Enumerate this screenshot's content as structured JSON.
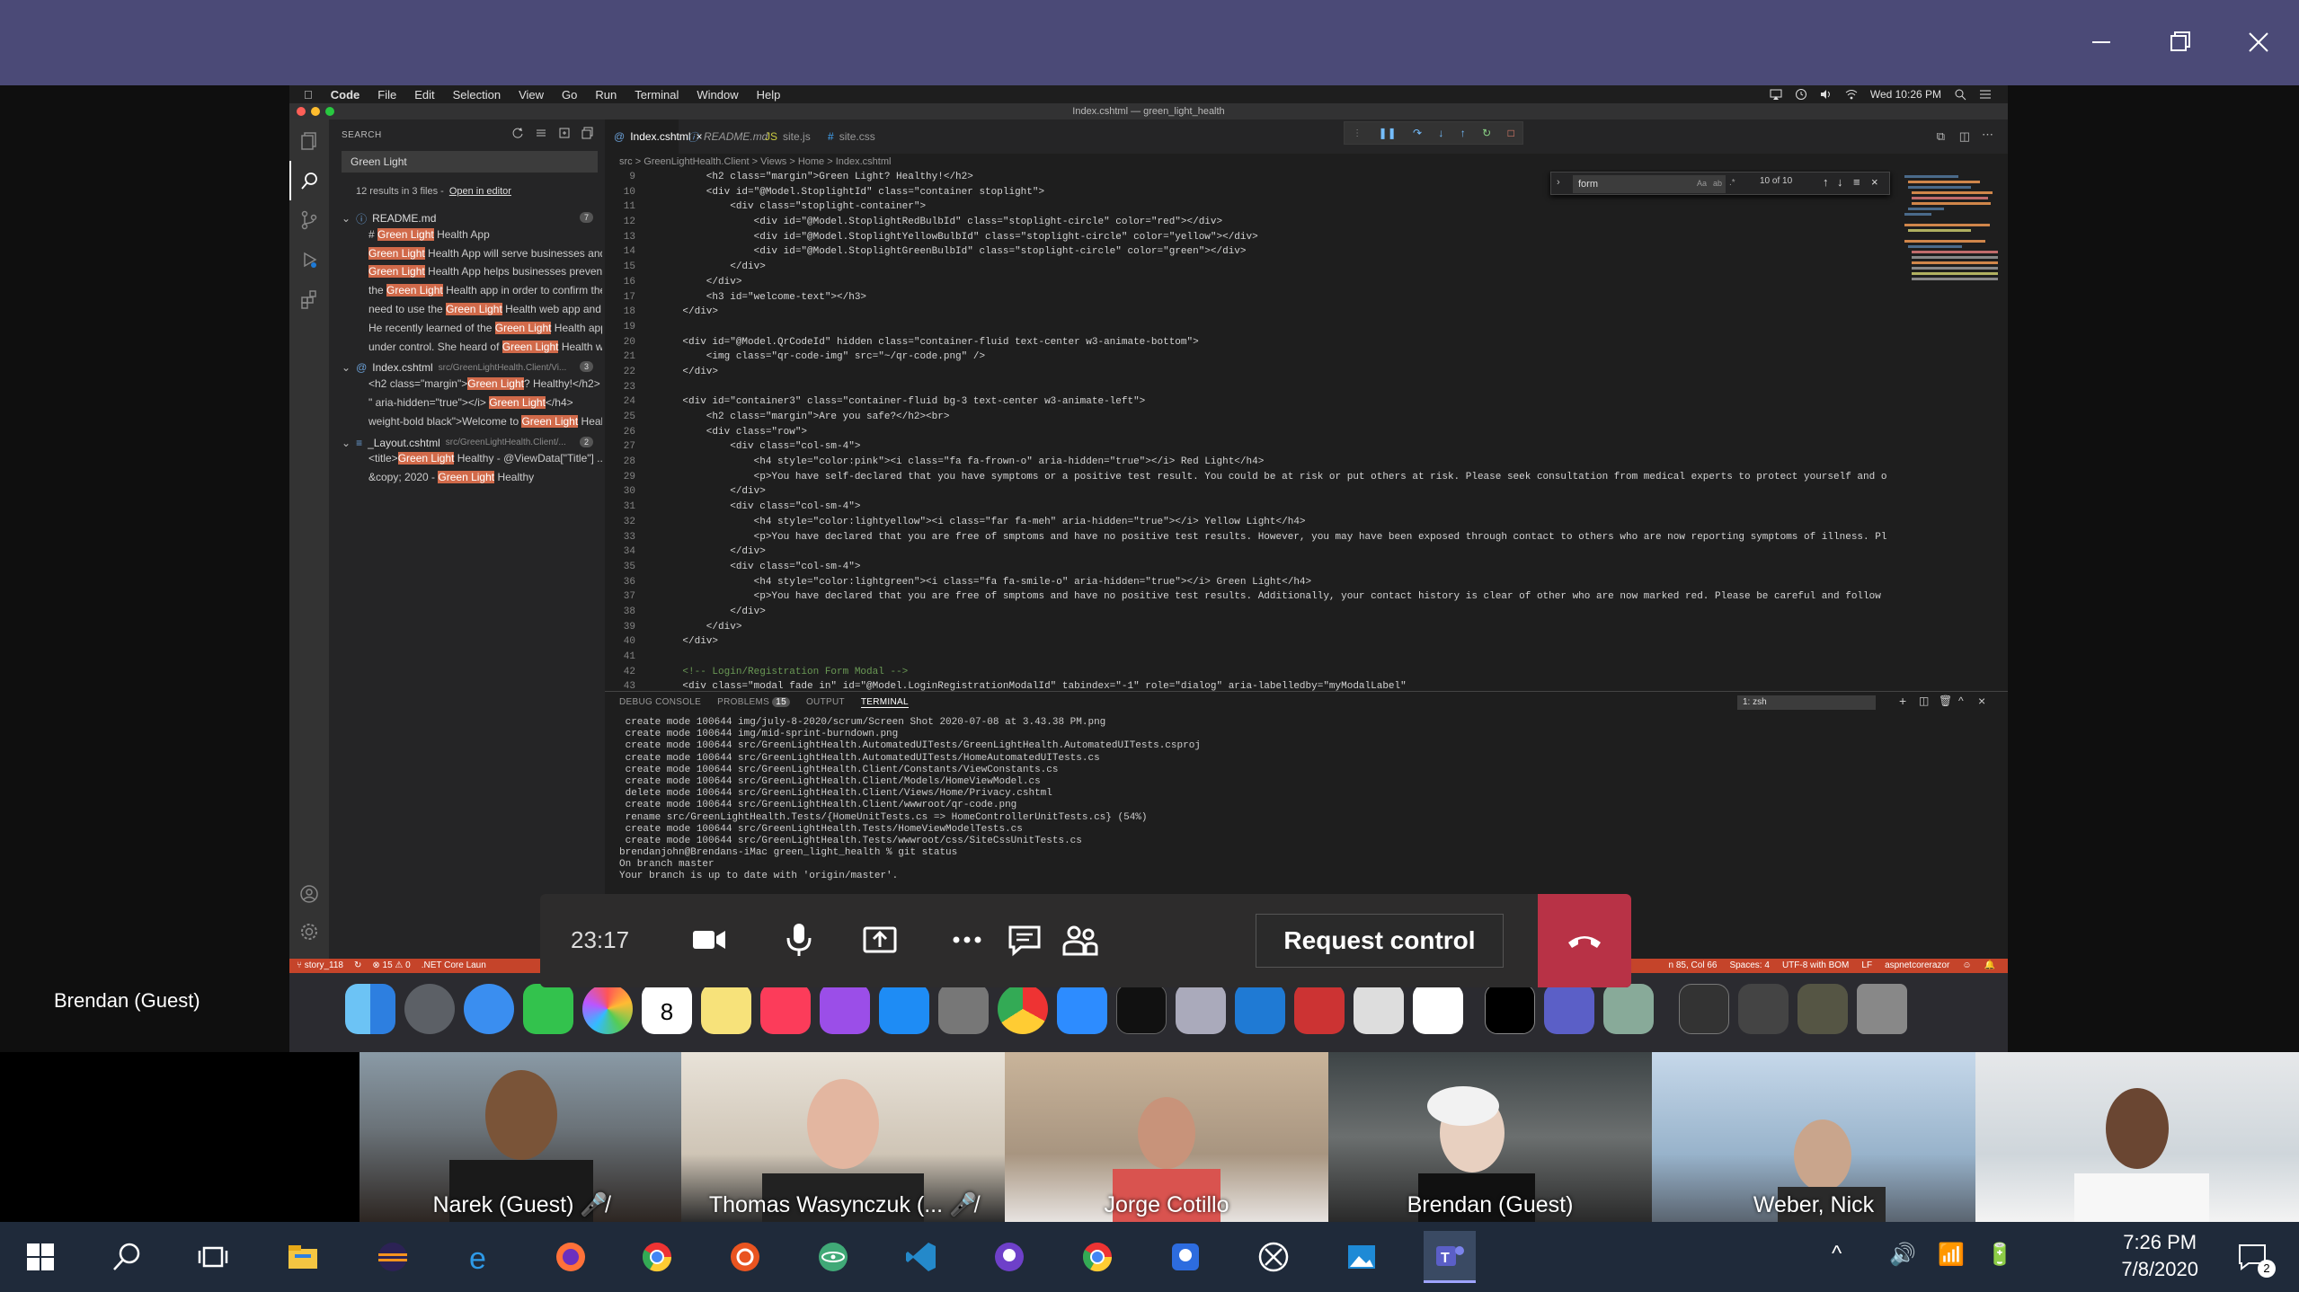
{
  "teams": {
    "presenter": "Brendan (Guest)",
    "timer": "23:17",
    "request_control": "Request control"
  },
  "mac_menubar": {
    "items": [
      "Code",
      "File",
      "Edit",
      "Selection",
      "View",
      "Go",
      "Run",
      "Terminal",
      "Window",
      "Help"
    ],
    "clock": "Wed 10:26 PM"
  },
  "vscode": {
    "window_title": "Index.cshtml — green_light_health",
    "sidebar": {
      "header": "SEARCH",
      "query": "Green Light",
      "summary": "12 results in 3 files -",
      "open_in_editor": "Open in editor",
      "files": [
        {
          "name": "README.md",
          "path": "",
          "count": "7",
          "lines": [
            {
              "pre": "# ",
              "hl": "Green Light",
              "post": " Health App"
            },
            {
              "pre": "",
              "hl": "Green Light",
              "post": " Health App will serve businesses and ..."
            },
            {
              "pre": "",
              "hl": "Green Light",
              "post": " Health App helps businesses prevent ..."
            },
            {
              "pre": "the ",
              "hl": "Green Light",
              "post": " Health app in order to confirm the..."
            },
            {
              "pre": "need to use the ",
              "hl": "Green Light",
              "post": " Health web app and c..."
            },
            {
              "pre": "He recently learned of the ",
              "hl": "Green Light",
              "post": " Health app..."
            },
            {
              "pre": "under control. She heard of ",
              "hl": "Green Light",
              "post": " Health we..."
            }
          ]
        },
        {
          "name": "Index.cshtml",
          "path": "src/GreenLightHealth.Client/Vi...",
          "count": "3",
          "lines": [
            {
              "pre": "<h2 class=\"margin\">",
              "hl": "Green Light",
              "post": "? Healthy!</h2>"
            },
            {
              "pre": "\" aria-hidden=\"true\"></i> ",
              "hl": "Green Light",
              "post": "</h4>"
            },
            {
              "pre": "weight-bold black\">Welcome to ",
              "hl": "Green Light",
              "post": " Healt..."
            }
          ]
        },
        {
          "name": "_Layout.cshtml",
          "path": "src/GreenLightHealth.Client/...",
          "count": "2",
          "lines": [
            {
              "pre": "<title>",
              "hl": "Green Light",
              "post": " Healthy - @ViewData[\"Title\"] ..."
            },
            {
              "pre": "&copy; 2020 - ",
              "hl": "Green Light",
              "post": " Healthy"
            }
          ]
        }
      ]
    },
    "tabs": [
      "Index.cshtml",
      "README.md",
      "site.js",
      "site.css"
    ],
    "breadcrumb": "src > GreenLightHealth.Client > Views > Home > Index.cshtml",
    "find": {
      "query": "form",
      "count": "10 of 10"
    },
    "line_numbers": [
      "9",
      "10",
      "11",
      "12",
      "13",
      "14",
      "15",
      "16",
      "17",
      "18",
      "19",
      "20",
      "21",
      "22",
      "23",
      "24",
      "25",
      "26",
      "27",
      "28",
      "29",
      "30",
      "31",
      "32",
      "33",
      "34",
      "35",
      "36",
      "37",
      "38",
      "39",
      "40",
      "41",
      "42",
      "43"
    ],
    "code_lines": [
      "        <h2 class=\"margin\">Green Light? Healthy!</h2>",
      "        <div id=\"@Model.StoplightId\" class=\"container stoplight\">",
      "            <div class=\"stoplight-container\">",
      "                <div id=\"@Model.StoplightRedBulbId\" class=\"stoplight-circle\" color=\"red\"></div>",
      "                <div id=\"@Model.StoplightYellowBulbId\" class=\"stoplight-circle\" color=\"yellow\"></div>",
      "                <div id=\"@Model.StoplightGreenBulbId\" class=\"stoplight-circle\" color=\"green\"></div>",
      "            </div>",
      "        </div>",
      "        <h3 id=\"welcome-text\"></h3>",
      "    </div>",
      "",
      "    <div id=\"@Model.QrCodeId\" hidden class=\"container-fluid text-center w3-animate-bottom\">",
      "        <img class=\"qr-code-img\" src=\"~/qr-code.png\" />",
      "    </div>",
      "",
      "    <div id=\"container3\" class=\"container-fluid bg-3 text-center w3-animate-left\">",
      "        <h2 class=\"margin\">Are you safe?</h2><br>",
      "        <div class=\"row\">",
      "            <div class=\"col-sm-4\">",
      "                <h4 style=\"color:pink\"><i class=\"fa fa-frown-o\" aria-hidden=\"true\"></i> Red Light</h4>",
      "                <p>You have self-declared that you have symptoms or a positive test result. You could be at risk or put others at risk. Please seek consultation from medical experts to protect yourself and o",
      "            </div>",
      "            <div class=\"col-sm-4\">",
      "                <h4 style=\"color:lightyellow\"><i class=\"far fa-meh\" aria-hidden=\"true\"></i> Yellow Light</h4>",
      "                <p>You have declared that you are free of smptoms and have no positive test results. However, you may have been exposed through contact to others who are now reporting symptoms of illness. Pl",
      "            </div>",
      "            <div class=\"col-sm-4\">",
      "                <h4 style=\"color:lightgreen\"><i class=\"fa fa-smile-o\" aria-hidden=\"true\"></i> Green Light</h4>",
      "                <p>You have declared that you are free of smptoms and have no positive test results. Additionally, your contact history is clear of other who are now marked red. Please be careful and follow",
      "            </div>",
      "        </div>",
      "    </div>",
      "",
      "    <!-- Login/Registration Form Modal -->",
      "    <div class=\"modal fade in\" id=\"@Model.LoginRegistrationModalId\" tabindex=\"-1\" role=\"dialog\" aria-labelledby=\"myModalLabel\""
    ],
    "panel": {
      "tabs": [
        "DEBUG CONSOLE",
        "PROBLEMS",
        "OUTPUT",
        "TERMINAL"
      ],
      "problems_count": "15",
      "shell": "1: zsh",
      "terminal_lines": [
        " create mode 100644 img/july-8-2020/scrum/Screen Shot 2020-07-08 at 3.43.38 PM.png",
        " create mode 100644 img/mid-sprint-burndown.png",
        " create mode 100644 src/GreenLightHealth.AutomatedUITests/GreenLightHealth.AutomatedUITests.csproj",
        " create mode 100644 src/GreenLightHealth.AutomatedUITests/HomeAutomatedUITests.cs",
        " create mode 100644 src/GreenLightHealth.Client/Constants/ViewConstants.cs",
        " create mode 100644 src/GreenLightHealth.Client/Models/HomeViewModel.cs",
        " delete mode 100644 src/GreenLightHealth.Client/Views/Home/Privacy.cshtml",
        " create mode 100644 src/GreenLightHealth.Client/wwwroot/qr-code.png",
        " rename src/GreenLightHealth.Tests/{HomeUnitTests.cs => HomeControllerUnitTests.cs} (54%)",
        " create mode 100644 src/GreenLightHealth.Tests/HomeViewModelTests.cs",
        " create mode 100644 src/GreenLightHealth.Tests/wwwroot/css/SiteCssUnitTests.cs",
        "brendanjohn@Brendans-iMac green_light_health % git status",
        "On branch master",
        "Your branch is up to date with 'origin/master'."
      ]
    },
    "status": {
      "left": [
        "story_118",
        "⊗ 15 ⚠ 0",
        ".NET Core Laun"
      ],
      "right": [
        "n 85, Col 66",
        "Spaces: 4",
        "UTF-8 with BOM",
        "LF",
        "aspnetcorerazor"
      ]
    }
  },
  "participants": [
    {
      "name": "Narek (Guest)"
    },
    {
      "name": "Thomas Wasynczuk (..."
    },
    {
      "name": "Jorge Cotillo"
    },
    {
      "name": "Brendan (Guest)"
    },
    {
      "name": "Weber, Nick"
    },
    {
      "name": ""
    }
  ],
  "taskbar": {
    "time": "7:26 PM",
    "date": "7/8/2020",
    "notification_count": "2"
  },
  "colors": {
    "teams_bar": "#4b4a77",
    "hangup": "#b83246",
    "vscode_status": "#c5442a",
    "highlight": "#d16a4a"
  }
}
